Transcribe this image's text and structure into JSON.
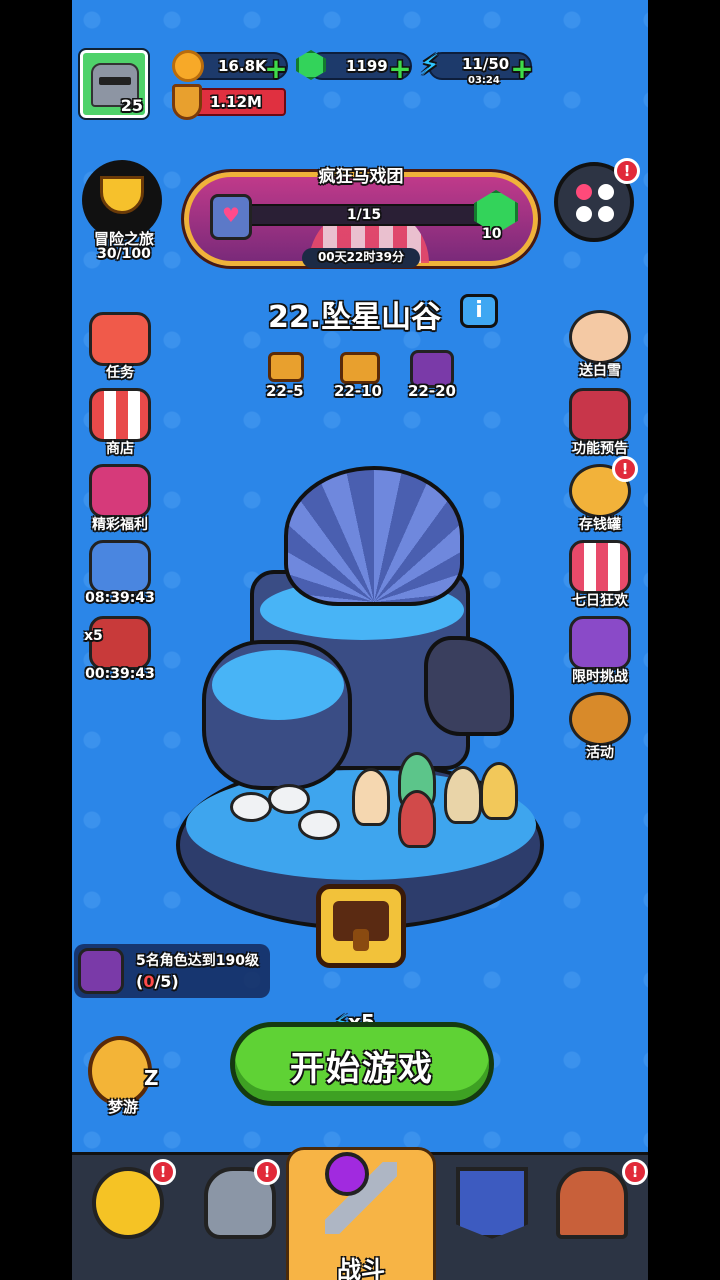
{
  "resources": {
    "gold": "16.8K",
    "gems": "1199",
    "energy": "11/50",
    "energy_timer": "03:24",
    "power": "1.12M",
    "player_level": "25"
  },
  "event": {
    "title": "疯狂马戏团",
    "progress": "1/15",
    "reward": "10",
    "timer": "00天22时39分"
  },
  "adventure": {
    "label": "冒险之旅",
    "progress": "30/100"
  },
  "stage": {
    "title": "22.坠星山谷",
    "rewards": [
      {
        "label": "22-5"
      },
      {
        "label": "22-10"
      },
      {
        "label": "22-20"
      }
    ]
  },
  "left_menu": [
    {
      "label": "任务"
    },
    {
      "label": "商店"
    },
    {
      "label": "精彩福利"
    },
    {
      "label": "08:39:43"
    },
    {
      "label": "00:39:43",
      "extra": "x5"
    }
  ],
  "right_menu": [
    {
      "label": "送白雪"
    },
    {
      "label": "功能预告"
    },
    {
      "label": "存钱罐"
    },
    {
      "label": "七日狂欢"
    },
    {
      "label": "限时挑战"
    },
    {
      "label": "活动"
    }
  ],
  "badge": "!",
  "quest": {
    "text": "5名角色达到190级",
    "progress_done": "0",
    "progress_total": "/5)",
    "progress_open": "("
  },
  "start": {
    "label": "开始游戏",
    "cost": "x5"
  },
  "idle": {
    "label": "梦游",
    "z": "Z"
  },
  "nav": {
    "tabs": [
      {
        "name": "sun"
      },
      {
        "name": "helmet"
      },
      {
        "name": "battle",
        "label": "战斗"
      },
      {
        "name": "crown"
      },
      {
        "name": "house"
      }
    ]
  },
  "colors": {
    "bg": "#2b86e8",
    "start": "#5fd235",
    "badge": "#e12a3a",
    "active_tab": "#f7b445"
  }
}
